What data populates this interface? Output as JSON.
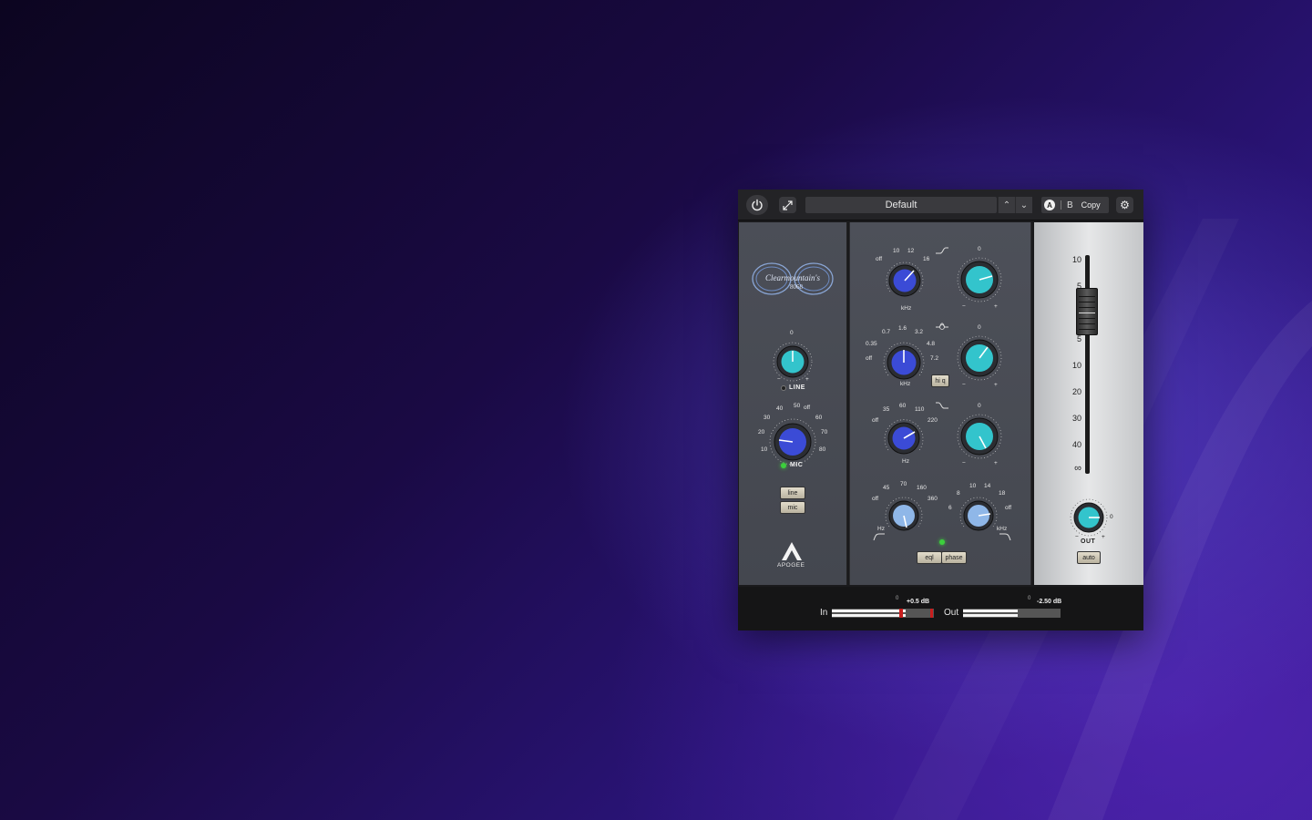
{
  "toolbar": {
    "preset_name": "Default",
    "ab_a": "A",
    "ab_b": "B",
    "copy_label": "Copy"
  },
  "left_panel": {
    "logo_text": "Clearmountain's",
    "logo_model": "8068",
    "line_knob": {
      "top": "0",
      "minus": "−",
      "plus": "+",
      "label": "LINE"
    },
    "mic_knob": {
      "scale": [
        "10",
        "20",
        "30",
        "40",
        "50",
        "off",
        "60",
        "70",
        "80"
      ],
      "label": "MIC"
    },
    "line_button": "line",
    "mic_button": "mic",
    "brand": "APOGEE"
  },
  "eq": {
    "high_freq": {
      "scale": [
        "off",
        "10",
        "12",
        "16"
      ],
      "unit": "kHz"
    },
    "high_gain": {
      "top": "0",
      "minus": "−",
      "plus": "+"
    },
    "mid_freq": {
      "scale": [
        "off",
        "0.35",
        "0.7",
        "1.6",
        "3.2",
        "4.8",
        "7.2"
      ],
      "unit": "kHz"
    },
    "mid_gain": {
      "top": "0",
      "minus": "−",
      "plus": "+"
    },
    "hiq_button": "hi q",
    "low_freq": {
      "scale": [
        "off",
        "35",
        "60",
        "110",
        "220"
      ],
      "unit": "Hz"
    },
    "low_gain": {
      "top": "0",
      "minus": "−",
      "plus": "+"
    },
    "hpf": {
      "scale": [
        "off",
        "45",
        "70",
        "160",
        "360"
      ],
      "unit": "Hz"
    },
    "lpf": {
      "scale": [
        "6",
        "8",
        "10",
        "14",
        "18",
        "off"
      ],
      "unit": "kHz"
    },
    "eql_button": "eql",
    "phase_button": "phase"
  },
  "fader": {
    "scale": [
      "10",
      "5",
      "0",
      "5",
      "10",
      "20",
      "30",
      "40",
      "∞"
    ],
    "out_knob": {
      "top": "0",
      "minus": "−",
      "plus": "+",
      "label": "OUT"
    },
    "auto_button": "auto"
  },
  "meters": {
    "in": {
      "label": "In",
      "zero": "0",
      "value": "+0.5 dB",
      "level": 0.72
    },
    "out": {
      "label": "Out",
      "zero": "0",
      "value": "-2.50 dB",
      "level": 0.56
    }
  },
  "colors": {
    "blue_knob": "#3b4bd6",
    "teal_knob": "#33c4cc",
    "light_knob": "#8fb7e8",
    "led_green": "#3ccf3c",
    "meter_red": "#c81e1e"
  }
}
